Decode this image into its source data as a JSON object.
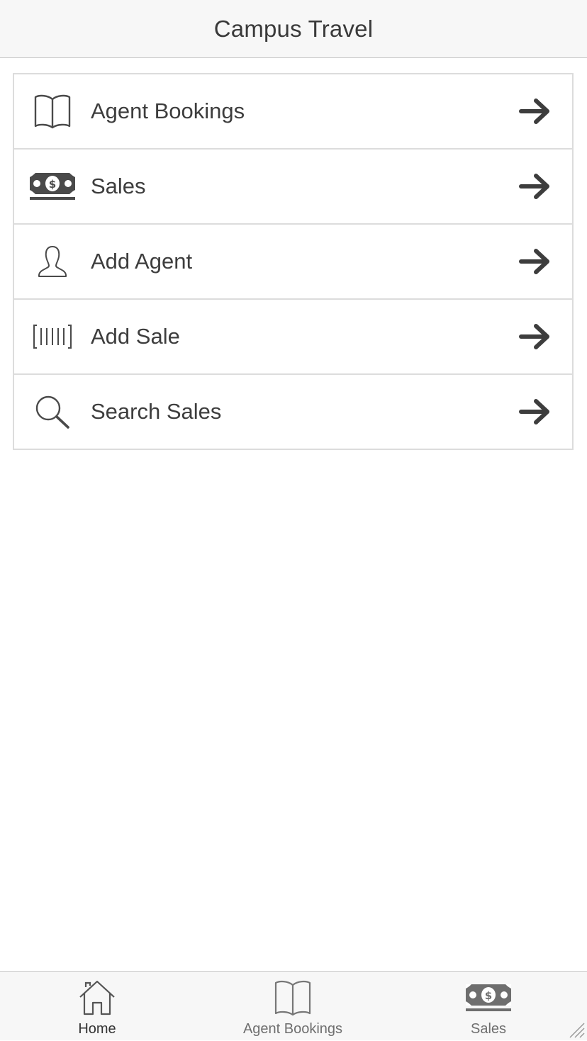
{
  "header": {
    "title": "Campus Travel"
  },
  "menu": {
    "items": [
      {
        "label": "Agent Bookings",
        "icon": "book-icon"
      },
      {
        "label": "Sales",
        "icon": "money-icon"
      },
      {
        "label": "Add Agent",
        "icon": "user-icon"
      },
      {
        "label": "Add Sale",
        "icon": "barcode-icon"
      },
      {
        "label": "Search Sales",
        "icon": "search-icon"
      }
    ],
    "arrow_icon": "arrow-right-icon"
  },
  "tabbar": {
    "tabs": [
      {
        "label": "Home",
        "icon": "home-icon",
        "active": true
      },
      {
        "label": "Agent Bookings",
        "icon": "book-icon",
        "active": false
      },
      {
        "label": "Sales",
        "icon": "money-icon",
        "active": false
      }
    ]
  },
  "colors": {
    "header_bg": "#f7f7f7",
    "text": "#3d3d3d",
    "border": "#dcdcdc",
    "icon": "#4a4a4a",
    "tab_inactive": "#6e6e6e"
  }
}
